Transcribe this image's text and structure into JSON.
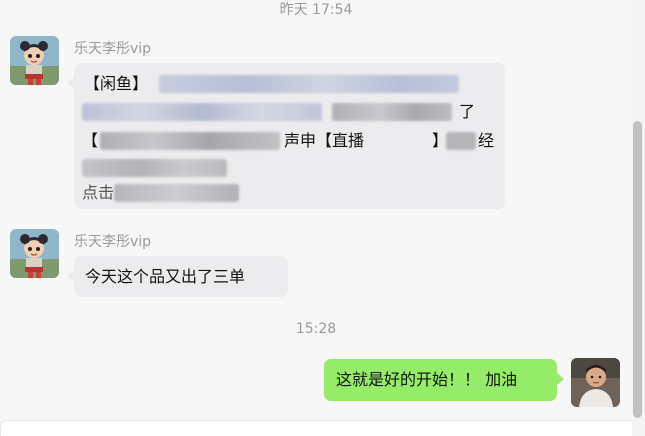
{
  "chat": {
    "timestamps": {
      "top": "昨天 17:54",
      "middle": "15:28"
    },
    "messages": [
      {
        "sender": "乐天李彤vip",
        "direction": "incoming",
        "visible_text": {
          "prefix": "【闲鱼】",
          "line3_fragment_a": "【",
          "line3_fragment_b": "声申【直播",
          "line3_fragment_c": "】",
          "line3_fragment_d": "经",
          "line2_end": "了",
          "line4_start": "点击"
        }
      },
      {
        "sender": "乐天李彤vip",
        "direction": "incoming",
        "text": "今天这个品又出了三单"
      },
      {
        "sender": "me",
        "direction": "outgoing",
        "text": "这就是好的开始！！ 加油"
      }
    ]
  },
  "colors": {
    "incoming_bubble": "#ececee",
    "outgoing_bubble": "#95ec69",
    "background": "#f7f7f8",
    "meta_text": "#9a9a9a"
  },
  "icons": {
    "sender_avatar": "cartoon-girl-avatar",
    "self_avatar": "user-photo-avatar"
  }
}
